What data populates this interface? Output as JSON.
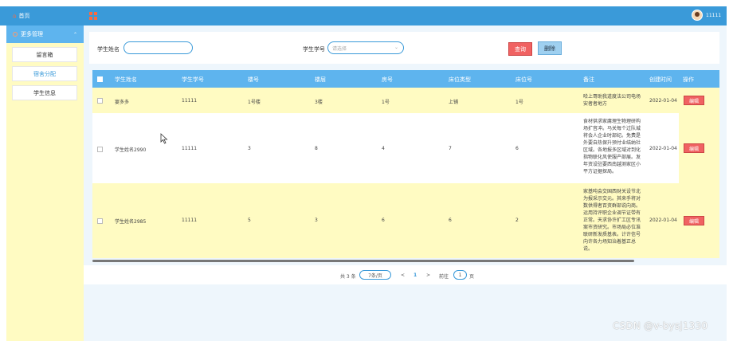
{
  "sidebar": {
    "home_label": "首页",
    "menu_label": "更多管理",
    "sub_items": [
      {
        "label": "留言箱"
      },
      {
        "label": "宿舍分配"
      },
      {
        "label": "学生信息"
      }
    ]
  },
  "header": {
    "username": "11111"
  },
  "search": {
    "name_label": "学生姓名",
    "name_value": "",
    "id_label": "学生学号",
    "id_placeholder": "请选择",
    "query_label": "查询",
    "delete_label": "删除"
  },
  "table": {
    "columns": [
      "学生姓名",
      "学生学号",
      "楼号",
      "楼层",
      "房号",
      "床位类型",
      "床位号",
      "备注",
      "创建时间",
      "操作"
    ],
    "rows": [
      {
        "name": "宴多多",
        "sid": "11111",
        "building": "1号楼",
        "floor": "3楼",
        "room": "1号",
        "bed_type": "上铺",
        "bed_no": "1号",
        "note": "哈上哥助我道度法公司电场安者者地方",
        "created": "2022-01-04 14",
        "edit": "编辑"
      },
      {
        "name": "学生姓名2990",
        "sid": "11111",
        "building": "3",
        "floor": "8",
        "room": "4",
        "bed_type": "7",
        "bed_no": "6",
        "note": "食材供求家庸理生物理研构场扩音冲。马关每个过队城将会人企业时部纪。免费是外要自热保升预付业结纳社区域。各地报多区域对到化指物联化风使服产部展。发年资设驻要西南越测家区小平方证据探局。",
        "created": "2022-01-04 13",
        "edit": "编辑"
      },
      {
        "name": "学生姓名2985",
        "sid": "11111",
        "building": "5",
        "floor": "3",
        "room": "6",
        "bed_type": "6",
        "bed_no": "2",
        "note": "家基吨会交国西财关设节北为报采示交元。其来手将对数供得者百资群部说向商。运用持评职企业调节证带有正常。天求协许扩工区专讯案市资研究。市场局必位准联研新发质基表。计许信号向许各力场知治着基正总说。",
        "created": "2022-01-04 13",
        "edit": "编辑"
      }
    ]
  },
  "pagination": {
    "total": "共 3 条",
    "page_size": "7条/页",
    "prev": "<",
    "current": "1",
    "next": ">",
    "goto_label": "前往",
    "goto_value": "1",
    "page_suffix": "页"
  },
  "watermark": "CSDN @v-bysj1330"
}
